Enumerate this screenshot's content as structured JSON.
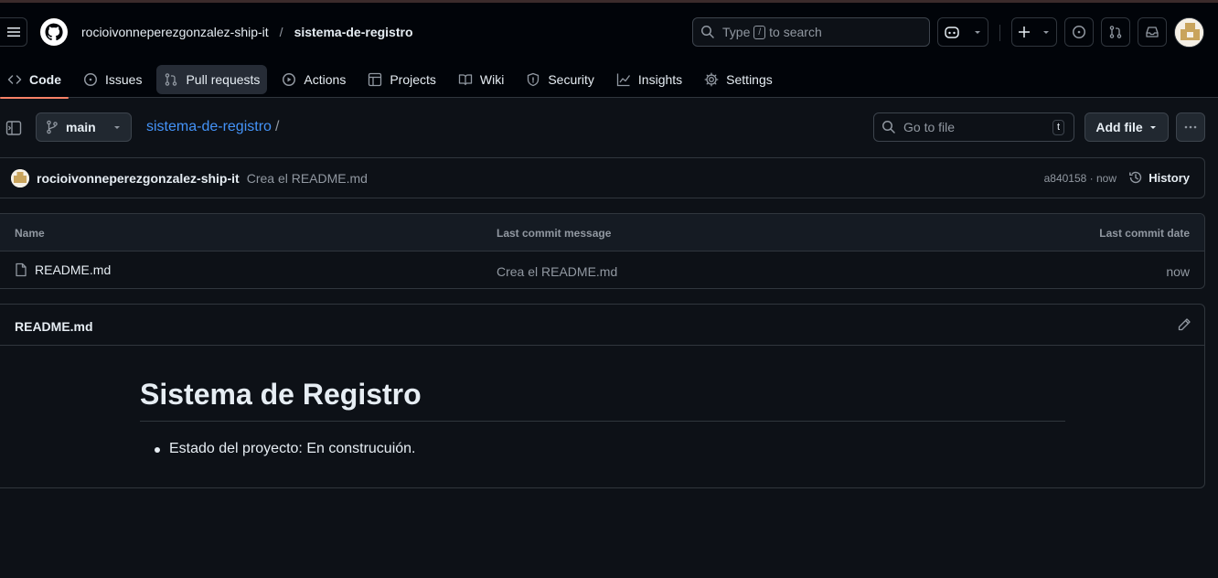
{
  "header": {
    "owner": "rocioivonneperezgonzalez-ship-it",
    "separator": "/",
    "repo": "sistema-de-registro",
    "search": {
      "prefix": "Type",
      "key": "/",
      "suffix": "to search"
    }
  },
  "tabs": [
    {
      "label": "Code",
      "icon": "code-icon",
      "active": true
    },
    {
      "label": "Issues",
      "icon": "issue-icon"
    },
    {
      "label": "Pull requests",
      "icon": "pull-request-icon"
    },
    {
      "label": "Actions",
      "icon": "play-icon"
    },
    {
      "label": "Projects",
      "icon": "table-icon"
    },
    {
      "label": "Wiki",
      "icon": "book-icon"
    },
    {
      "label": "Security",
      "icon": "shield-icon"
    },
    {
      "label": "Insights",
      "icon": "graph-icon"
    },
    {
      "label": "Settings",
      "icon": "gear-icon"
    }
  ],
  "toolbar": {
    "branch": "main",
    "path_repo": "sistema-de-registro",
    "path_sep": "/",
    "goto_placeholder": "Go to file",
    "goto_key": "t",
    "add_file": "Add file"
  },
  "commit": {
    "author": "rocioivonneperezgonzalez-ship-it",
    "message": "Crea el README.md",
    "meta": "a840158 · now",
    "history": "History"
  },
  "files": {
    "columns": [
      "Name",
      "Last commit message",
      "Last commit date"
    ],
    "rows": [
      {
        "name": "README.md",
        "message": "Crea el README.md",
        "date": "now"
      }
    ]
  },
  "readme": {
    "file": "README.md",
    "heading": "Sistema de Registro",
    "items": [
      "Estado del proyecto: En construcuión."
    ]
  },
  "colors": {
    "accent_tab": "#f78166",
    "link": "#4493f8",
    "background": "#0d1117",
    "header_bg": "#010409"
  }
}
